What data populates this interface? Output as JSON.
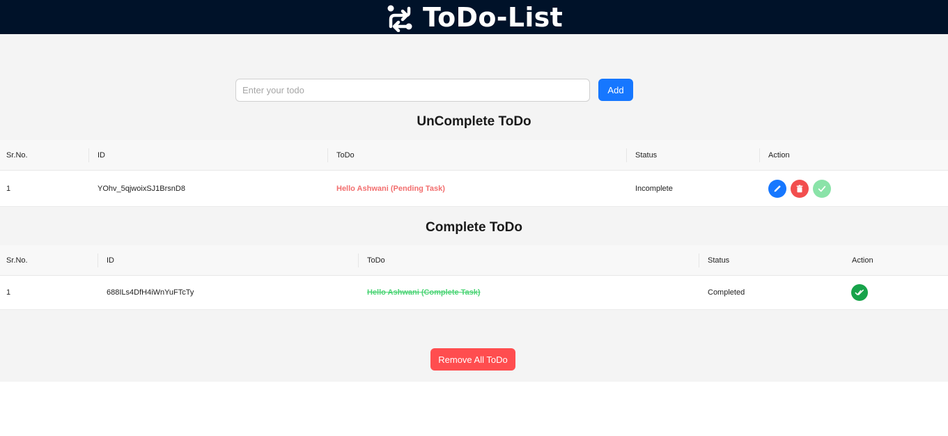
{
  "header": {
    "title": "ToDo-List",
    "logo_icon": "swap-arrows-icon"
  },
  "input": {
    "placeholder": "Enter your todo",
    "value": ""
  },
  "add_button": "Add",
  "uncomplete": {
    "title": "UnComplete ToDo",
    "columns": [
      "Sr.No.",
      "ID",
      "ToDo",
      "Status",
      "Action"
    ],
    "rows": [
      {
        "srno": "1",
        "id": "YOhv_5qjwoixSJ1BrsnD8",
        "todo": "Hello Ashwani (Pending Task)",
        "status": "Incomplete"
      }
    ]
  },
  "complete": {
    "title": "Complete ToDo",
    "columns": [
      "Sr.No.",
      "ID",
      "ToDo",
      "Status",
      "Action"
    ],
    "rows": [
      {
        "srno": "1",
        "id": "688ILs4DfH4iWnYuFTcTy",
        "todo": "Hello Ashwani (Complete Task)",
        "status": "Completed"
      }
    ]
  },
  "remove_all_button": "Remove All ToDo",
  "colors": {
    "header_bg": "#001229",
    "primary": "#1677ff",
    "danger": "#ff4d4f",
    "pending_text": "#f26e6e",
    "complete_text": "#4bd475",
    "success": "#17a34a"
  }
}
